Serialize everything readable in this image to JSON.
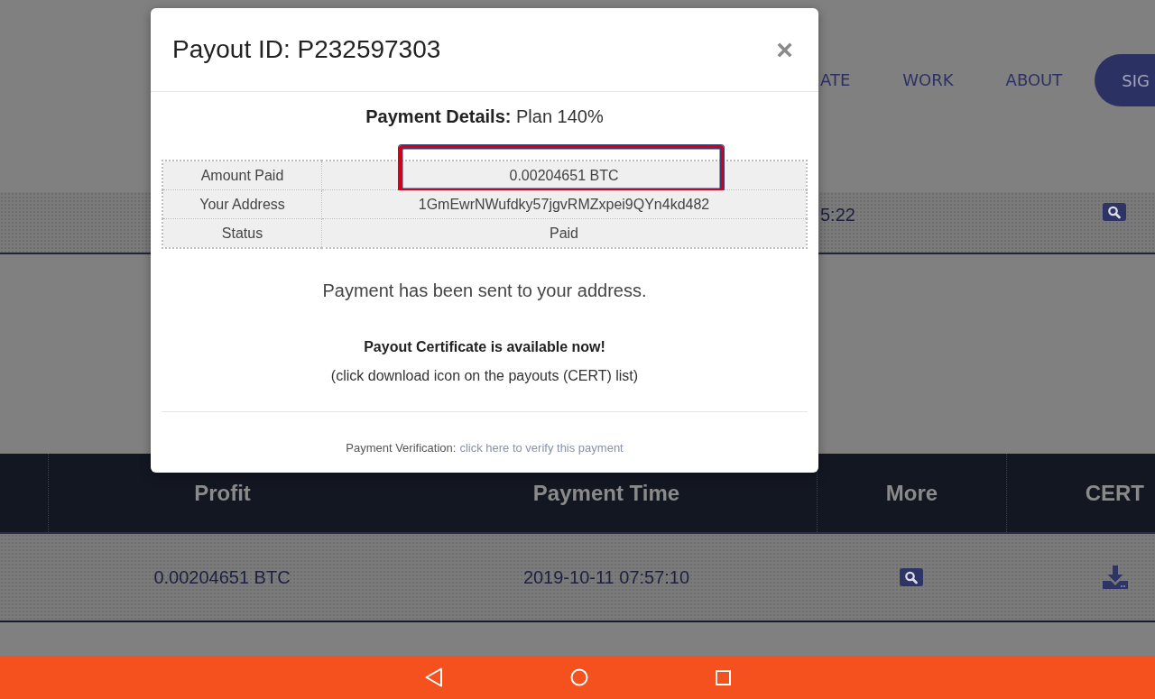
{
  "background_page": {
    "nav": {
      "links": [
        "ATE",
        "WORK",
        "ABOUT"
      ],
      "sign_button": "SIG"
    },
    "top_row": {
      "time": "5:22"
    },
    "table": {
      "columns": [
        "Profit",
        "Payment Time",
        "More",
        "CERT"
      ],
      "rows": [
        {
          "profit": "0.00204651 BTC",
          "payment_time": "2019-10-11 07:57:10"
        }
      ]
    }
  },
  "modal": {
    "title": "Payout ID: P232597303",
    "close": "×",
    "details_heading": "**Payment Details:** Plan 140%",
    "details": [
      {
        "label": "Amount Paid",
        "value": "0.00204651 BTC",
        "highlighted": true
      },
      {
        "label": "Your Address",
        "value": "1GmEwrNWufdky57jgvRMZxpei9QYn4kd482",
        "highlighted": false
      },
      {
        "label": "Status",
        "value": "Paid",
        "highlighted": false
      }
    ],
    "message": "Payment has been sent to your address.",
    "certificate_notice": "Payout Certificate is available now!",
    "certificate_hint": "(click download icon on the payouts (CERT) list)",
    "verification_label": "Payment Verification:",
    "verification_link": "click here to verify this payment"
  }
}
